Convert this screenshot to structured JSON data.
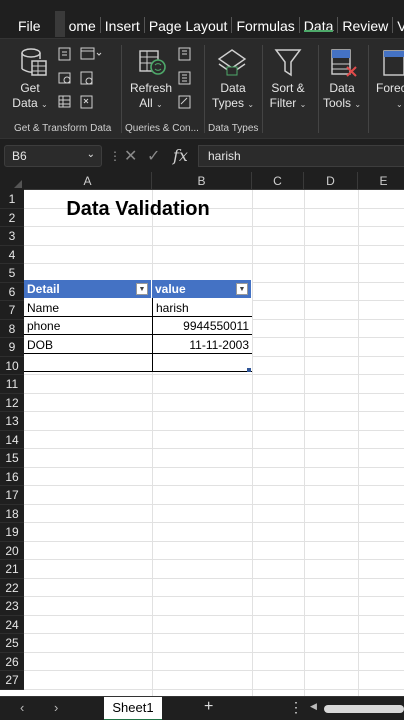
{
  "menu": {
    "tabs": [
      "File",
      "ome",
      "Insert",
      "Page Layout",
      "Formulas",
      "Data",
      "Review",
      "View"
    ],
    "active": "Data"
  },
  "ribbon": {
    "get_data": {
      "line1": "Get",
      "line2": "Data"
    },
    "refresh_all": {
      "line1": "Refresh",
      "line2": "All"
    },
    "data_types": {
      "line1": "Data",
      "line2": "Types"
    },
    "sort_filter": {
      "line1": "Sort &",
      "line2": "Filter"
    },
    "data_tools": {
      "line1": "Data",
      "line2": "Tools"
    },
    "forecast": {
      "line1": "Forec"
    },
    "groups": {
      "get_transform": "Get & Transform Data",
      "queries": "Queries & Con...",
      "data_types": "Data Types"
    }
  },
  "formula_bar": {
    "name_box": "B6",
    "content": "harish"
  },
  "columns": [
    "A",
    "B",
    "C",
    "D",
    "E"
  ],
  "rows": [
    "1",
    "2",
    "3",
    "4",
    "5",
    "6",
    "7",
    "8",
    "9",
    "10",
    "11",
    "12",
    "13",
    "14",
    "15",
    "16",
    "17",
    "18",
    "19",
    "20",
    "21",
    "22",
    "23",
    "24",
    "25",
    "26",
    "27"
  ],
  "sheet": {
    "title": "Data Validation",
    "table": {
      "headers": [
        "Detail",
        "value"
      ],
      "rows": [
        [
          "Name",
          "harish"
        ],
        [
          "phone",
          "9944550011"
        ],
        [
          "DOB",
          "11-11-2003"
        ],
        [
          "",
          ""
        ]
      ]
    }
  },
  "sheet_tabs": {
    "active": "Sheet1",
    "add": "+",
    "more": "⋮"
  },
  "colors": {
    "accent": "#217346",
    "table_header": "#4472c4",
    "active_tab_underline": "#4ea96a"
  }
}
